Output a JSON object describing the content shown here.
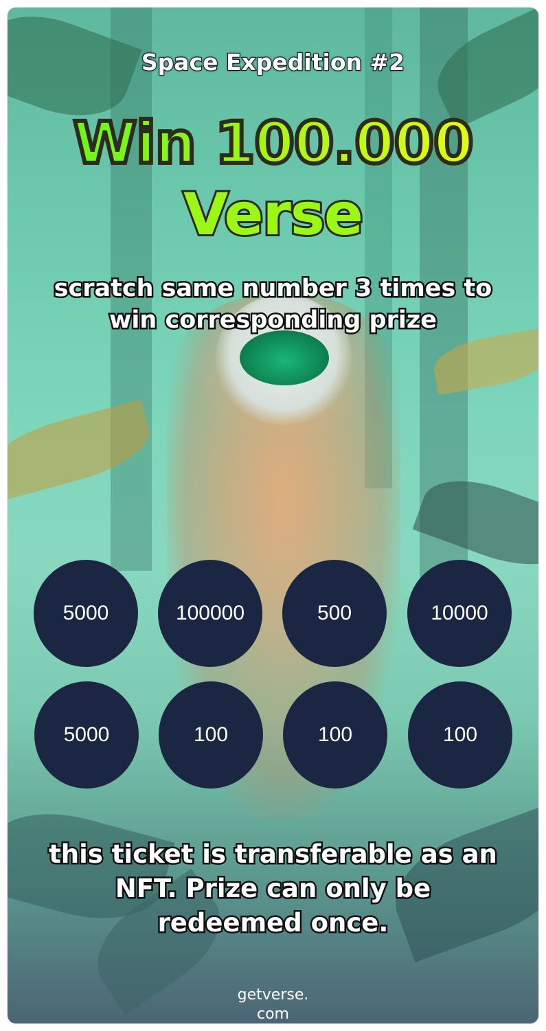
{
  "ticket": {
    "series_title": "Space Expedition #2",
    "headline_line1": "Win 100.000",
    "headline_line2": "Verse",
    "instructions": "scratch same number 3 times to win corresponding prize",
    "disclaimer": "this ticket is transferable as an NFT. Prize can only be redeemed once.",
    "footer_line1": "getverse.",
    "footer_line2": "com"
  },
  "scratch_fields": [
    {
      "value": "5000"
    },
    {
      "value": "100000"
    },
    {
      "value": "500"
    },
    {
      "value": "10000"
    },
    {
      "value": "5000"
    },
    {
      "value": "100"
    },
    {
      "value": "100"
    },
    {
      "value": "100"
    }
  ],
  "colors": {
    "coin_background": "#1b2643",
    "headline_green": "#8cf219",
    "headline_yellow": "#f3ff16",
    "text_white": "#ffffff"
  }
}
